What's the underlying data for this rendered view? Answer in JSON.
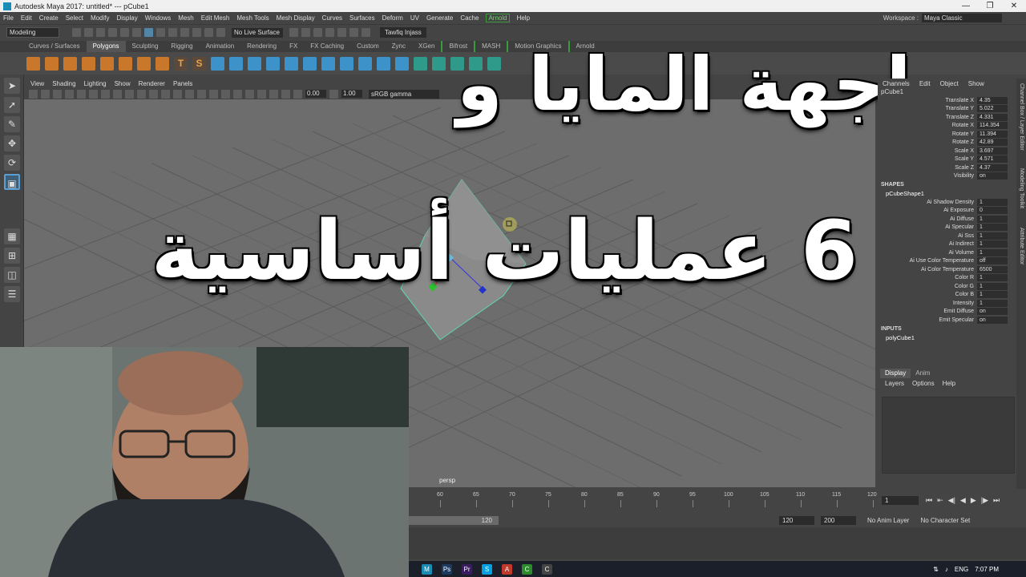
{
  "window": {
    "title": "Autodesk Maya 2017: untitled*   ---   pCube1",
    "controls": [
      "—",
      "❐",
      "✕"
    ]
  },
  "menubar": {
    "items": [
      "File",
      "Edit",
      "Create",
      "Select",
      "Modify",
      "Display",
      "Windows",
      "Mesh",
      "Edit Mesh",
      "Mesh Tools",
      "Mesh Display",
      "Curves",
      "Surfaces",
      "Deform",
      "UV",
      "Generate",
      "Cache",
      "Arnold",
      "Help"
    ],
    "workspace_label": "Workspace :",
    "workspace_value": "Maya Classic"
  },
  "statusline": {
    "mode": "Modeling",
    "live_surface": "No Live Surface",
    "user": "Tawfiq Injass"
  },
  "shelf_tabs": [
    "Curves / Surfaces",
    "Polygons",
    "Sculpting",
    "Rigging",
    "Animation",
    "Rendering",
    "FX",
    "FX Caching",
    "Custom",
    "Zync",
    "XGen",
    "Bifrost",
    "MASH",
    "Motion Graphics",
    "Arnold"
  ],
  "shelf_active": "Polygons",
  "viewport": {
    "menu": [
      "View",
      "Shading",
      "Lighting",
      "Show",
      "Renderer",
      "Panels"
    ],
    "exposure": "0.00",
    "gamma": "1.00",
    "color_space": "sRGB gamma",
    "camera": "persp"
  },
  "overlay": {
    "line1": "واجهة المايا و",
    "line2": "6 عمليات أساسية"
  },
  "channel_box": {
    "menu": [
      "Channels",
      "Edit",
      "Object",
      "Show"
    ],
    "object": "pCube1",
    "transform": [
      {
        "name": "Translate X",
        "value": "4.35"
      },
      {
        "name": "Translate Y",
        "value": "5.022"
      },
      {
        "name": "Translate Z",
        "value": "4.331"
      },
      {
        "name": "Rotate X",
        "value": "114.354"
      },
      {
        "name": "Rotate Y",
        "value": "11.394"
      },
      {
        "name": "Rotate Z",
        "value": "42.89"
      },
      {
        "name": "Scale X",
        "value": "3.697"
      },
      {
        "name": "Scale Y",
        "value": "4.571"
      },
      {
        "name": "Scale Z",
        "value": "4.37"
      },
      {
        "name": "Visibility",
        "value": "on"
      }
    ],
    "shapes_label": "SHAPES",
    "shape_name": "pCubeShape1",
    "shape_attrs": [
      {
        "name": "Ai Shadow Density",
        "value": "1"
      },
      {
        "name": "Ai Exposure",
        "value": "0"
      },
      {
        "name": "Ai Diffuse",
        "value": "1"
      },
      {
        "name": "Ai Specular",
        "value": "1"
      },
      {
        "name": "Ai Sss",
        "value": "1"
      },
      {
        "name": "Ai Indirect",
        "value": "1"
      },
      {
        "name": "Ai Volume",
        "value": "1"
      },
      {
        "name": "Ai Use Color Temperature",
        "value": "off"
      },
      {
        "name": "Ai Color Temperature",
        "value": "6500"
      },
      {
        "name": "Color R",
        "value": "1"
      },
      {
        "name": "Color G",
        "value": "1"
      },
      {
        "name": "Color B",
        "value": "1"
      },
      {
        "name": "Intensity",
        "value": "1"
      },
      {
        "name": "Emit Diffuse",
        "value": "on"
      },
      {
        "name": "Emit Specular",
        "value": "on"
      }
    ],
    "inputs_label": "INPUTS",
    "input_name": "polyCube1"
  },
  "side_tabs": [
    "Channel Box / Layer Editor",
    "Modeling Toolkit",
    "Attribute Editor"
  ],
  "layer_panel": {
    "tabs": [
      "Display",
      "Anim"
    ],
    "menu": [
      "Layers",
      "Options",
      "Help"
    ]
  },
  "timeline": {
    "ticks": [
      "60",
      "65",
      "70",
      "75",
      "80",
      "85",
      "90",
      "95",
      "100",
      "105",
      "110",
      "115",
      "120"
    ],
    "current_frame": "1",
    "range_end": "120",
    "end_frame": "120",
    "max_frame": "200",
    "anim_layer": "No Anim Layer",
    "character_set": "No Character Set"
  },
  "taskbar": {
    "language": "ENG",
    "time": "7:07 PM",
    "apps": [
      {
        "label": "M",
        "color": "#1a8cb5"
      },
      {
        "label": "Ps",
        "color": "#1c3a5e"
      },
      {
        "label": "Pr",
        "color": "#3a1d5e"
      },
      {
        "label": "S",
        "color": "#00a1e0"
      },
      {
        "label": "A",
        "color": "#c0392b"
      },
      {
        "label": "C",
        "color": "#2d8a2d"
      },
      {
        "label": "C",
        "color": "#444444"
      }
    ]
  },
  "colors": {
    "accent_blue": "#5285a6",
    "arnold_green": "#3b9a3b",
    "viewport_bg": "#6d6d6d"
  }
}
